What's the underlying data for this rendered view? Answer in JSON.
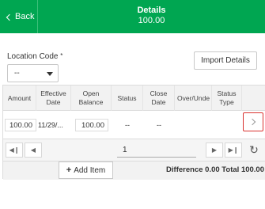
{
  "header": {
    "back_label": "Back",
    "title": "Details",
    "subtitle": "100.00"
  },
  "form": {
    "location_label": "Location Code",
    "required_mark": "*",
    "location_value": "--",
    "import_label": "Import Details"
  },
  "table": {
    "columns": [
      "Amount",
      "Effective Date",
      "Open Balance",
      "Status",
      "Close Date",
      "Over/Under",
      "Status Type"
    ],
    "column_lines": [
      [
        "Amount"
      ],
      [
        "Effective",
        "Date"
      ],
      [
        "Open",
        "Balance"
      ],
      [
        "Status"
      ],
      [
        "Close",
        "Date"
      ],
      [
        "Over/Unde"
      ],
      [
        "Status",
        "Type"
      ]
    ],
    "rows": [
      {
        "amount": "100.00",
        "effective_date": "11/29/...",
        "open_balance": "100.00",
        "status": "--",
        "close_date": "--",
        "over_under": "",
        "status_type": ""
      }
    ]
  },
  "pager": {
    "page": "1"
  },
  "footer": {
    "add_label": "Add Item",
    "difference_label": "Difference",
    "difference_value": "0.00",
    "total_label": "Total",
    "total_value": "100.00"
  },
  "colors": {
    "header_bg": "#00a651",
    "highlight_border": "#d9322f"
  },
  "icons": {
    "back": "chevron-left-icon",
    "dropdown": "caret-down-icon",
    "row_detail": "chevron-right-icon",
    "first": "first-page-icon",
    "prev": "prev-page-icon",
    "next": "next-page-icon",
    "last": "last-page-icon",
    "refresh": "refresh-icon",
    "add": "plus-icon"
  }
}
